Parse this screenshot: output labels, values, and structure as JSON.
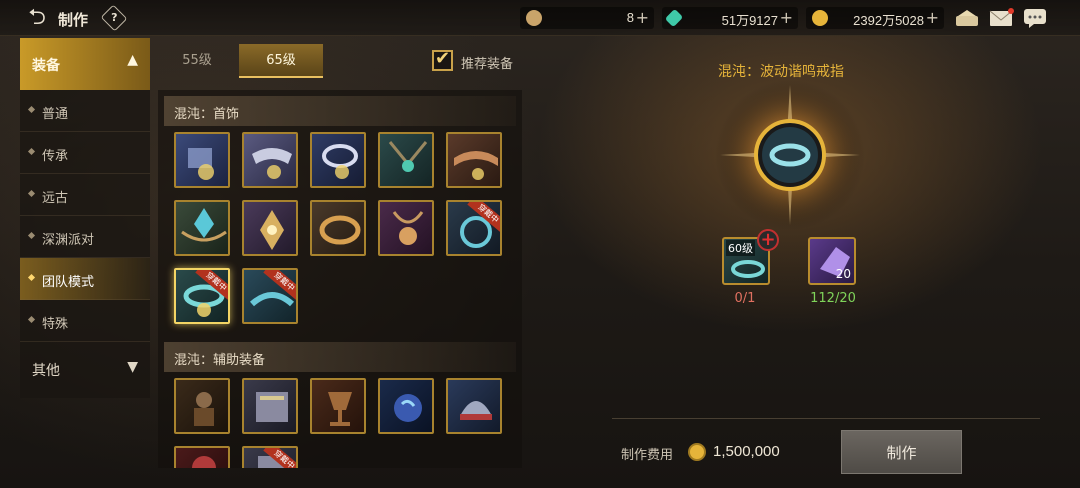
{
  "topbar": {
    "title": "制作",
    "help": "?",
    "resources": [
      {
        "name": "coin-c",
        "value": "8",
        "color": "#c9a46a"
      },
      {
        "name": "crystal",
        "value": "51万9127",
        "color": "#3fc9a8"
      },
      {
        "name": "gold",
        "value": "2392万5028",
        "color": "#e6b43a"
      }
    ],
    "plus": "+"
  },
  "leftnav": {
    "header": "装备",
    "items": [
      "普通",
      "传承",
      "远古",
      "深渊派对",
      "团队模式",
      "特殊"
    ],
    "active_index": 4,
    "other": "其他"
  },
  "level_tabs": [
    "55级",
    "65级"
  ],
  "active_level_tab": 1,
  "recommend": {
    "label": "推荐装备",
    "checked": true
  },
  "sections": [
    {
      "title": "混沌：首饰"
    },
    {
      "title": "混沌：辅助装备"
    }
  ],
  "badge_text": "穿戴中",
  "target": {
    "name": "混沌：波动谐鸣戒指"
  },
  "materials": [
    {
      "level_tag": "60级",
      "count": "0/1",
      "count_color": "#e07060"
    },
    {
      "stack": "20",
      "count": "112/20",
      "count_color": "#7fd45a"
    }
  ],
  "cost": {
    "label": "制作费用",
    "value": "1,500,000"
  },
  "craft_button": "制作"
}
